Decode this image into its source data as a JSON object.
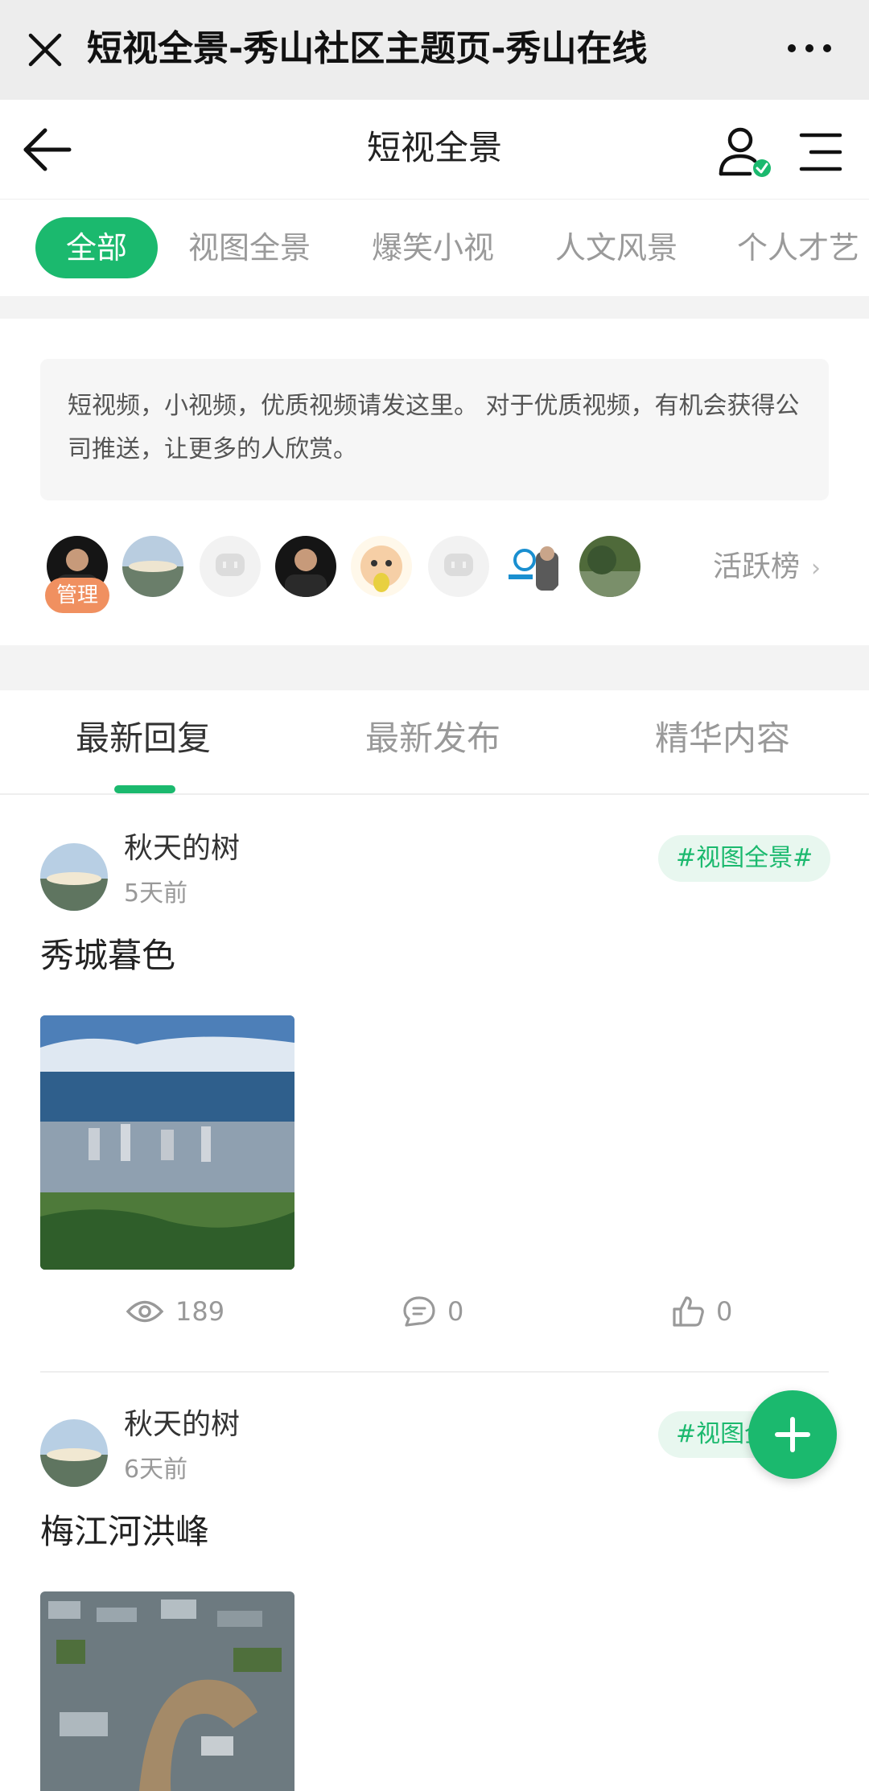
{
  "wechat": {
    "title": "短视全景-秀山社区主题页-秀山在线",
    "close_icon": "close-icon",
    "more_icon": "more-dots-icon"
  },
  "header": {
    "title": "短视全景",
    "back_icon": "arrow-left-icon",
    "user_icon": "user-verified-icon",
    "menu_icon": "menu-icon",
    "accent": "#1bb96e"
  },
  "categories": {
    "items": [
      {
        "label": "全部",
        "active": true
      },
      {
        "label": "视图全景",
        "active": false
      },
      {
        "label": "爆笑小视",
        "active": false
      },
      {
        "label": "人文风景",
        "active": false
      },
      {
        "label": "个人才艺",
        "active": false
      }
    ]
  },
  "intro": {
    "text": "短视频，小视频，优质视频请发这里。 对于优质视频，有机会获得公司推送，让更多的人欣赏。"
  },
  "members": {
    "admin_badge": "管理",
    "rank_label": "活跃榜"
  },
  "sort_tabs": {
    "items": [
      {
        "label": "最新回复",
        "active": true
      },
      {
        "label": "最新发布",
        "active": false
      },
      {
        "label": "精华内容",
        "active": false
      }
    ]
  },
  "posts": [
    {
      "author": "秋天的树",
      "time": "5天前",
      "tag": "#视图全景#",
      "title": "秀城暮色",
      "views": "189",
      "comments": "0",
      "likes": "0"
    },
    {
      "author": "秋天的树",
      "time": "6天前",
      "tag": "#视图全景#",
      "title": "梅江河洪峰"
    }
  ],
  "fab": {
    "icon": "plus-icon"
  }
}
